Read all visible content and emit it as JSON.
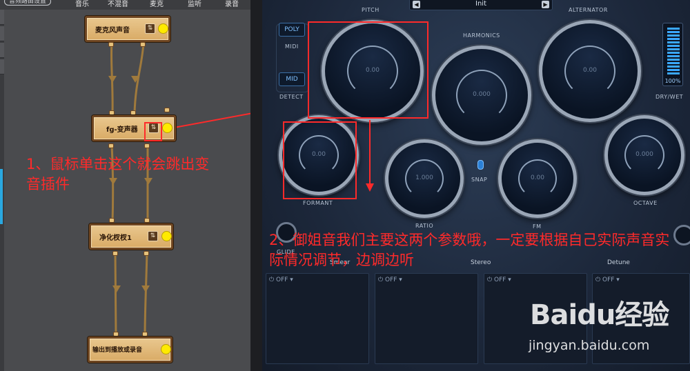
{
  "left_panel": {
    "window_title": "音频路由设置",
    "channel_tabs": [
      "音乐",
      "不混音",
      "麦克",
      "监听",
      "录音"
    ],
    "nodes": [
      {
        "label": "麦克风声音",
        "icon": "mixer-icon"
      },
      {
        "label": "fg-变声器",
        "icon": "mixer-icon"
      },
      {
        "label": "净化杈杈1",
        "icon": "mixer-icon"
      },
      {
        "label": "输出到播放或录音",
        "icon": "mixer-icon"
      }
    ],
    "annotation": "1、鼠标单击这个就会跳出变音插件"
  },
  "plugin": {
    "preset": {
      "name": "Init",
      "prev": "◀",
      "next": "▶"
    },
    "labels": {
      "pitch": "PITCH",
      "harmonics": "HARMONICS",
      "alternator": "ALTERNATOR",
      "formant": "FORMANT",
      "ratio": "RATIO",
      "snap": "SNAP",
      "fm": "FM",
      "octave": "OCTAVE",
      "midi": "MIDI",
      "detect": "DETECT",
      "dry_wet": "DRY/WET",
      "glide": "GLIDE"
    },
    "mode_buttons": {
      "poly": "POLY",
      "mid": "MID"
    },
    "knobs": {
      "pitch": "0.00",
      "harmonics": "0.000",
      "alternator": "0.00",
      "formant": "0.00",
      "ratio": "1.000",
      "fm": "0.00",
      "octave": "0.000"
    },
    "dry_wet_value": "100%",
    "fx_names": [
      "Smear",
      "Stereo",
      "Detune"
    ],
    "fx_slots": [
      {
        "state": "OFF ▾"
      },
      {
        "state": "OFF ▾"
      },
      {
        "state": "OFF ▾"
      },
      {
        "state": "OFF ▾"
      }
    ],
    "annotation": "2、御姐音我们主要这两个参数哦，一定要根据自己实际声音实际情况调节，边调边听"
  },
  "watermark": {
    "logo": "Baidu经验",
    "url": "jingyan.baidu.com"
  },
  "colors": {
    "annotation": "#ff2a2a",
    "node_dot": "#ffea00",
    "accent": "#2aa8e0"
  }
}
